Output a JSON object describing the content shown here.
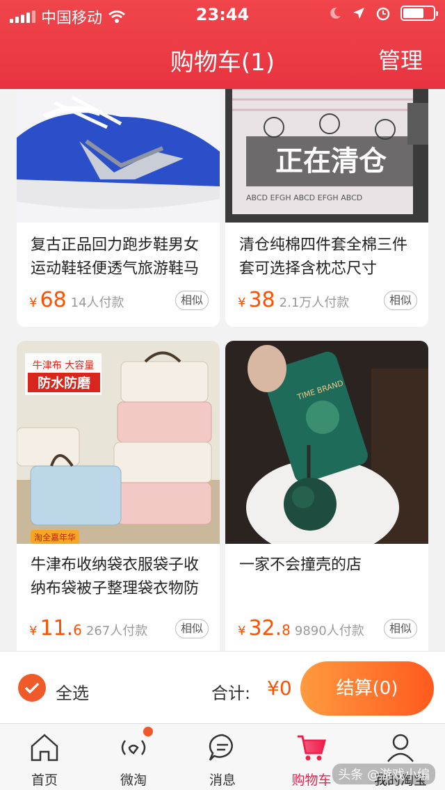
{
  "status": {
    "carrier": "中国移动",
    "time": "23:44"
  },
  "header": {
    "title": "购物车(1)",
    "manage": "管理"
  },
  "products": [
    {
      "name": "复古正品回力跑步鞋男女运动鞋轻便透气旅游鞋马",
      "currency": "¥",
      "price_int": "68",
      "price_dec": "",
      "sold": "14人付款",
      "similar": "相似",
      "image": "blue-sneaker"
    },
    {
      "name": "清仓纯棉四件套全棉三件套可选择含枕芯尺寸",
      "currency": "¥",
      "price_int": "38",
      "price_dec": "",
      "sold": "2.1万人付款",
      "similar": "相似",
      "image": "bedding-set",
      "overlay": "正在清仓"
    },
    {
      "name": "牛津布收纳袋衣服袋子收纳布袋被子整理袋衣物防",
      "currency": "¥",
      "price_int": "11.",
      "price_dec": "6",
      "sold": "267人付款",
      "similar": "相似",
      "image": "storage-bags",
      "badge_top": "牛津布 大容量",
      "badge_main": "防水防磨",
      "badge_bottom": "淘全嘉年华"
    },
    {
      "name": "一家不会撞壳的店",
      "currency": "¥",
      "price_int": "32.",
      "price_dec": "8",
      "sold": "9890人付款",
      "similar": "相似",
      "image": "phone-case",
      "case_text": "TIME BRAND"
    }
  ],
  "checkout": {
    "select_all": "全选",
    "total_label": "合计:",
    "total_value": "¥0",
    "button": "结算(0)"
  },
  "tabs": [
    {
      "label": "首页",
      "icon": "home-icon",
      "active": false
    },
    {
      "label": "微淘",
      "icon": "weitao-icon",
      "active": false,
      "badge": true
    },
    {
      "label": "消息",
      "icon": "message-icon",
      "active": false
    },
    {
      "label": "购物车",
      "icon": "cart-icon",
      "active": true
    },
    {
      "label": "我的淘宝",
      "icon": "profile-icon",
      "active": false
    }
  ],
  "watermark": "头条 @游戏小编"
}
